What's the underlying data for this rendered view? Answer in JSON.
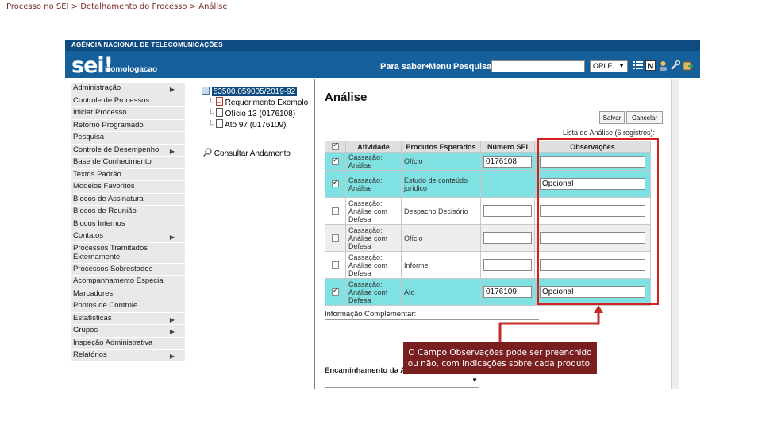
{
  "breadcrumb": "Processo no SEI > Detalhamento do Processo > Análise",
  "header": {
    "agency": "AGÊNCIA NACIONAL DE TELECOMUNICAÇÕES",
    "logo": "sei!",
    "environment": "Homologacao",
    "links": {
      "para_saber": "Para saber+",
      "menu": "Menu",
      "pesquisa": "Pesquisa"
    },
    "search_value": "",
    "unit_value": "ORLE"
  },
  "sidebar": {
    "items": [
      {
        "label": "Administração",
        "submenu": true
      },
      {
        "label": "Controle de Processos",
        "submenu": false
      },
      {
        "label": "Iniciar Processo",
        "submenu": false
      },
      {
        "label": "Retorno Programado",
        "submenu": false
      },
      {
        "label": "Pesquisa",
        "submenu": false
      },
      {
        "label": "Controle de Desempenho",
        "submenu": true
      },
      {
        "label": "Base de Conhecimento",
        "submenu": false
      },
      {
        "label": "Textos Padrão",
        "submenu": false
      },
      {
        "label": "Modelos Favoritos",
        "submenu": false
      },
      {
        "label": "Blocos de Assinatura",
        "submenu": false
      },
      {
        "label": "Blocos de Reunião",
        "submenu": false
      },
      {
        "label": "Blocos Internos",
        "submenu": false
      },
      {
        "label": "Contatos",
        "submenu": true
      },
      {
        "label": "Processos Tramitados Externamente",
        "submenu": false
      },
      {
        "label": "Processos Sobrestados",
        "submenu": false
      },
      {
        "label": "Acompanhamento Especial",
        "submenu": false
      },
      {
        "label": "Marcadores",
        "submenu": false
      },
      {
        "label": "Pontos de Controle",
        "submenu": false
      },
      {
        "label": "Estatísticas",
        "submenu": true
      },
      {
        "label": "Grupos",
        "submenu": true
      },
      {
        "label": "Inspeção Administrativa",
        "submenu": false
      },
      {
        "label": "Relatórios",
        "submenu": true
      }
    ]
  },
  "tree": {
    "process_number": "53500.059005/2019-92",
    "documents": [
      {
        "label": "Requerimento Exemplo"
      },
      {
        "label": "Ofício 13 (0176108)"
      },
      {
        "label": "Ato 97 (0176109)"
      }
    ],
    "consult": "Consultar Andamento"
  },
  "main": {
    "title": "Análise",
    "buttons": {
      "salvar": "Salvar",
      "cancelar": "Cancelar"
    },
    "list_caption": "Lista de Análise (6 registros):",
    "columns": [
      "Atividade",
      "Produtos Esperados",
      "Número SEI",
      "Observações"
    ],
    "rows": [
      {
        "checked": true,
        "atividade": "Cassação: Análise",
        "produto": "Ofício",
        "numero": "0176108",
        "observacao": "",
        "has_numero_input": true
      },
      {
        "checked": true,
        "atividade": "Cassação: Análise",
        "produto": "Estudo de conteúdo jurídico",
        "numero": "",
        "observacao": "Opcional",
        "has_numero_input": false
      },
      {
        "checked": false,
        "atividade": "Cassação: Análise com Defesa",
        "produto": "Despacho Decisório",
        "numero": "",
        "observacao": "",
        "has_numero_input": true
      },
      {
        "checked": false,
        "atividade": "Cassação: Análise com Defesa",
        "produto": "Ofício",
        "numero": "",
        "observacao": "",
        "has_numero_input": true
      },
      {
        "checked": false,
        "atividade": "Cassação: Análise com Defesa",
        "produto": "Informe",
        "numero": "",
        "observacao": "",
        "has_numero_input": true
      },
      {
        "checked": true,
        "atividade": "Cassação: Análise com Defesa",
        "produto": "Ato",
        "numero": "0176109",
        "observacao": "Opcional",
        "has_numero_input": true
      }
    ],
    "complementary_info": "Informação Complementar:",
    "routing_label": "Encaminhamento da A"
  },
  "callout": "O Campo Observações pode ser preenchido ou não, com indicações sobre cada produto.",
  "colors": {
    "header": "#155f9b",
    "agency_bar": "#0f4b80",
    "selected_row": "#7fe1e2",
    "highlight": "#d42020",
    "callout": "#7a1f1f"
  }
}
